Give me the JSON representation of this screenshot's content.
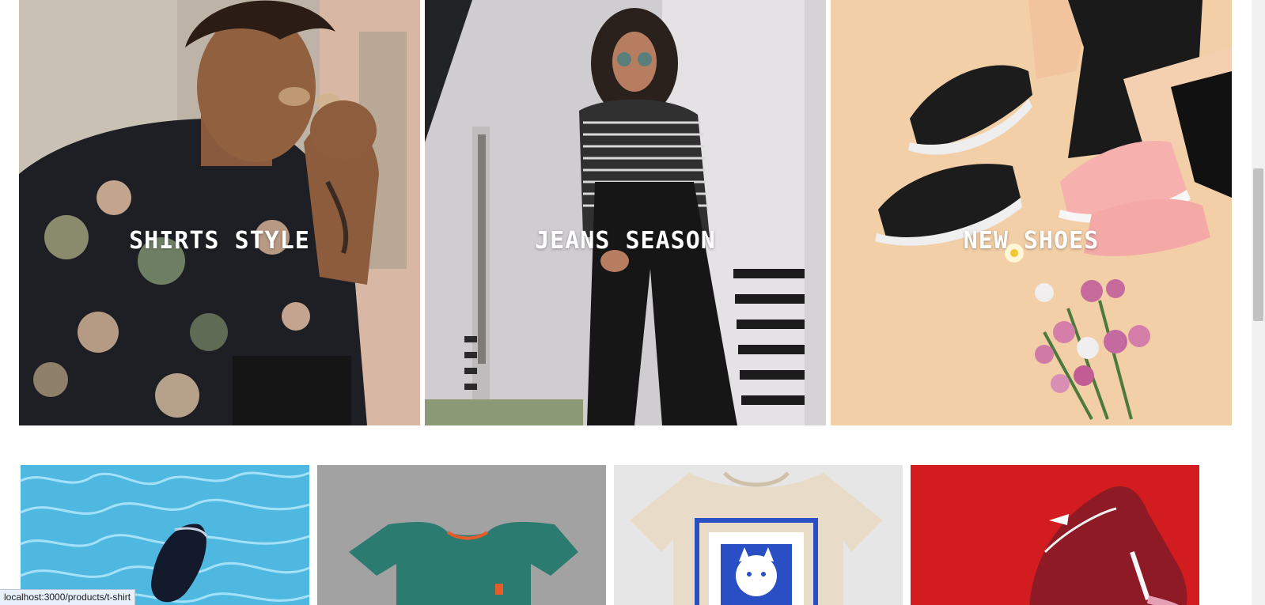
{
  "hero_categories": [
    {
      "label": "SHIRTS STYLE",
      "image": "man in floral shirt and sunglasses"
    },
    {
      "label": "JEANS SEASON",
      "image": "woman in striped top and wide black pants"
    },
    {
      "label": "NEW SHOES",
      "image": "sneakers with pink flowers on beige background"
    }
  ],
  "products": [
    {
      "image": "black slide sandal floating in pool water"
    },
    {
      "image": "teal t-shirt on concrete"
    },
    {
      "image": "cream t-shirt with blue cat print"
    },
    {
      "image": "red sneaker on red background"
    }
  ],
  "status_bar": {
    "url": "localhost:3000/products/t-shirt"
  },
  "colors": {
    "label_text": "#ffffff",
    "status_bg": "#e8f0fb",
    "scroll_thumb": "#c1c1c1"
  }
}
